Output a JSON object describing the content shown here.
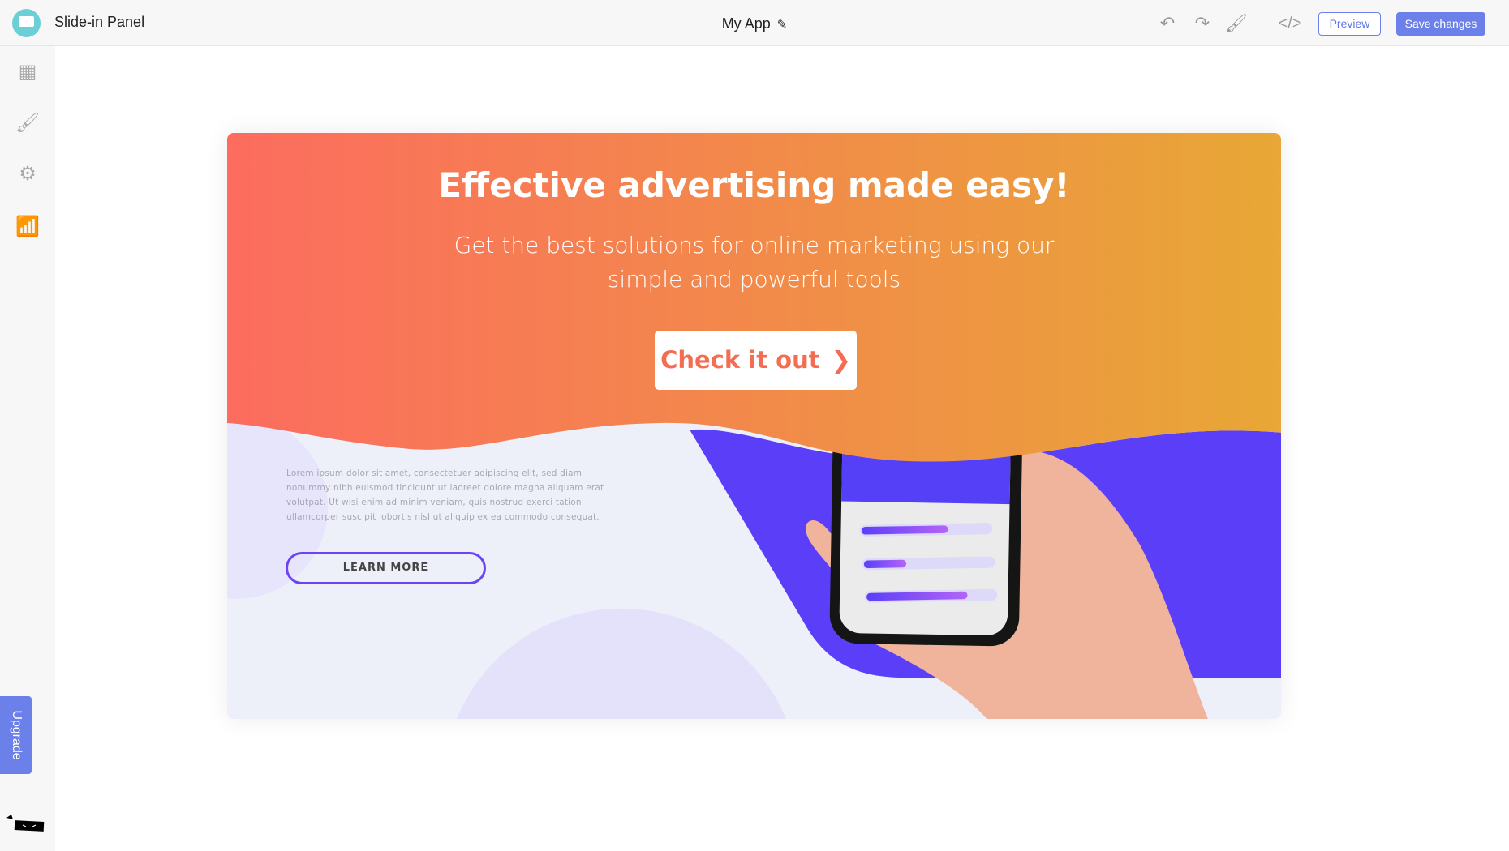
{
  "header": {
    "app_name": "Slide-in Panel",
    "project_title": "My App",
    "preview_label": "Preview",
    "save_label": "Save changes"
  },
  "icons": {
    "logo": "chat-bubble-icon",
    "edit": "pencil-icon",
    "undo": "undo-icon",
    "redo": "redo-icon",
    "paint": "paint-roller-icon",
    "code": "code-icon"
  },
  "sidebar": {
    "items": [
      {
        "icon": "layout-icon"
      },
      {
        "icon": "brush-icon"
      },
      {
        "icon": "gear-icon"
      },
      {
        "icon": "analytics-icon"
      }
    ],
    "upgrade_label": "Upgrade"
  },
  "banner": {
    "title": "Effective advertising made easy!",
    "subtitle_line1": "Get the best solutions for online marketing using our",
    "subtitle_line2": "simple and powerful tools",
    "cta_label": "Check it out",
    "body": "Lorem ipsum dolor sit amet, consectetuer adipiscing elit, sed diam nonummy nibh euismod tincidunt ut laoreet dolore magna aliquam erat volutpat. Ut wisi enim ad minim veniam, quis nostrud exerci tation ullamcorper suscipit lobortis nisl ut aliquip ex ea commodo consequat.",
    "learn_more_label": "LEARN MORE"
  },
  "colors": {
    "accent": "#6b80e8",
    "gradient_start": "#fc6c5f",
    "gradient_end": "#e8a736",
    "purple": "#5b3ff8",
    "cta_text": "#f36d52"
  }
}
